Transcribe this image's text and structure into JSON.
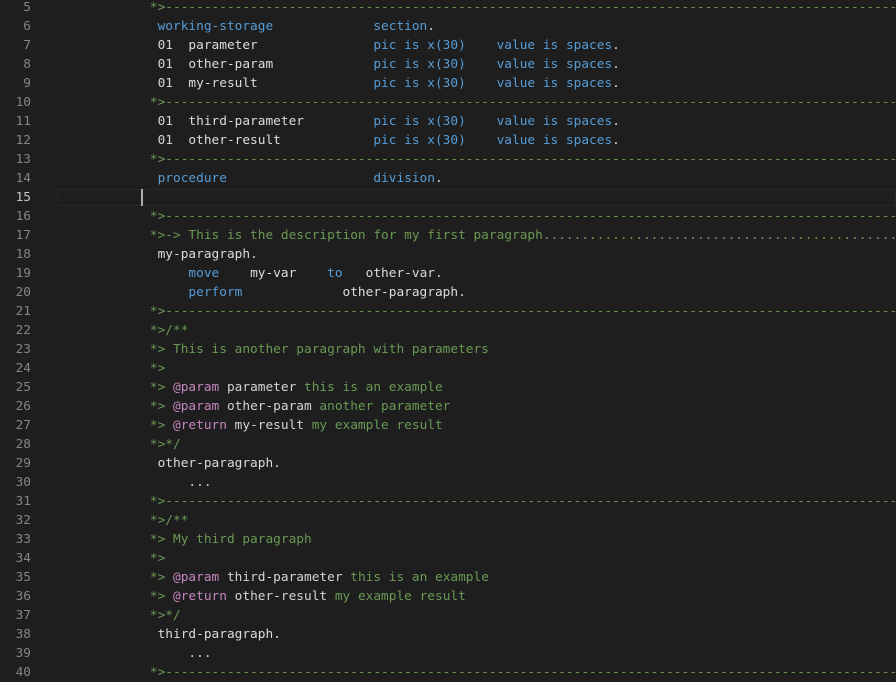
{
  "editor": {
    "colors": {
      "background": "#1e1e1e",
      "line_number": "#858585",
      "active_line_number": "#c6c6c6",
      "comment": "#6a9955",
      "keyword": "#569cd6",
      "identifier": "#dcdcdc",
      "doc_tag": "#c586c0"
    },
    "active_line": 15,
    "lines": [
      {
        "n": "5",
        "segs": [
          {
            "t": "comment",
            "v": "      *>------------------------------------------------------------------------------------------------------"
          }
        ]
      },
      {
        "n": "6",
        "segs": [
          {
            "t": "kw",
            "v": "       working-storage             section"
          },
          {
            "t": "plain",
            "v": "."
          }
        ]
      },
      {
        "n": "7",
        "segs": [
          {
            "t": "plain",
            "v": "       01  "
          },
          {
            "t": "name",
            "v": "parameter"
          },
          {
            "t": "kw",
            "v": "               pic is x(30)    value is spaces"
          },
          {
            "t": "plain",
            "v": "."
          }
        ]
      },
      {
        "n": "8",
        "segs": [
          {
            "t": "plain",
            "v": "       01  "
          },
          {
            "t": "name",
            "v": "other-param"
          },
          {
            "t": "kw",
            "v": "             pic is x(30)    value is spaces"
          },
          {
            "t": "plain",
            "v": "."
          }
        ]
      },
      {
        "n": "9",
        "segs": [
          {
            "t": "plain",
            "v": "       01  "
          },
          {
            "t": "name",
            "v": "my-result"
          },
          {
            "t": "kw",
            "v": "               pic is x(30)    value is spaces"
          },
          {
            "t": "plain",
            "v": "."
          }
        ]
      },
      {
        "n": "10",
        "segs": [
          {
            "t": "comment",
            "v": "      *>------------------------------------------------------------------------------------------------------"
          }
        ]
      },
      {
        "n": "11",
        "segs": [
          {
            "t": "plain",
            "v": "       01  "
          },
          {
            "t": "name",
            "v": "third-parameter"
          },
          {
            "t": "kw",
            "v": "         pic is x(30)    value is spaces"
          },
          {
            "t": "plain",
            "v": "."
          }
        ]
      },
      {
        "n": "12",
        "segs": [
          {
            "t": "plain",
            "v": "       01  "
          },
          {
            "t": "name",
            "v": "other-result"
          },
          {
            "t": "kw",
            "v": "            pic is x(30)    value is spaces"
          },
          {
            "t": "plain",
            "v": "."
          }
        ]
      },
      {
        "n": "13",
        "segs": [
          {
            "t": "comment",
            "v": "      *>------------------------------------------------------------------------------------------------------"
          }
        ]
      },
      {
        "n": "14",
        "segs": [
          {
            "t": "kw",
            "v": "       procedure                   division"
          },
          {
            "t": "plain",
            "v": "."
          }
        ]
      },
      {
        "n": "15",
        "segs": []
      },
      {
        "n": "16",
        "segs": [
          {
            "t": "comment",
            "v": "      *>------------------------------------------------------------------------------------------------------"
          }
        ]
      },
      {
        "n": "17",
        "segs": [
          {
            "t": "comment",
            "v": "      *>-> This is the description for my first paragraph......................................................"
          }
        ]
      },
      {
        "n": "18",
        "segs": [
          {
            "t": "name",
            "v": "       my-paragraph"
          },
          {
            "t": "plain",
            "v": "."
          }
        ]
      },
      {
        "n": "19",
        "segs": [
          {
            "t": "kw",
            "v": "           move    "
          },
          {
            "t": "name",
            "v": "my-var"
          },
          {
            "t": "kw",
            "v": "    to   "
          },
          {
            "t": "name",
            "v": "other-var"
          },
          {
            "t": "plain",
            "v": "."
          }
        ]
      },
      {
        "n": "20",
        "segs": [
          {
            "t": "kw",
            "v": "           perform             "
          },
          {
            "t": "name",
            "v": "other-paragraph"
          },
          {
            "t": "plain",
            "v": "."
          }
        ]
      },
      {
        "n": "21",
        "segs": [
          {
            "t": "comment",
            "v": "      *>------------------------------------------------------------------------------------------------------"
          }
        ]
      },
      {
        "n": "22",
        "segs": [
          {
            "t": "comment",
            "v": "      *>/**"
          }
        ]
      },
      {
        "n": "23",
        "segs": [
          {
            "t": "comment",
            "v": "      *> This is another paragraph with parameters"
          }
        ]
      },
      {
        "n": "24",
        "segs": [
          {
            "t": "comment",
            "v": "      *>"
          }
        ]
      },
      {
        "n": "25",
        "segs": [
          {
            "t": "comment",
            "v": "      *> "
          },
          {
            "t": "tag",
            "v": "@param"
          },
          {
            "t": "plain",
            "v": " parameter"
          },
          {
            "t": "comment",
            "v": " this is an example"
          }
        ]
      },
      {
        "n": "26",
        "segs": [
          {
            "t": "comment",
            "v": "      *> "
          },
          {
            "t": "tag",
            "v": "@param"
          },
          {
            "t": "plain",
            "v": " other-param"
          },
          {
            "t": "comment",
            "v": " another parameter"
          }
        ]
      },
      {
        "n": "27",
        "segs": [
          {
            "t": "comment",
            "v": "      *> "
          },
          {
            "t": "tag",
            "v": "@return"
          },
          {
            "t": "plain",
            "v": " my-result"
          },
          {
            "t": "comment",
            "v": " my example result"
          }
        ]
      },
      {
        "n": "28",
        "segs": [
          {
            "t": "comment",
            "v": "      *>*/"
          }
        ]
      },
      {
        "n": "29",
        "segs": [
          {
            "t": "name",
            "v": "       other-paragraph"
          },
          {
            "t": "plain",
            "v": "."
          }
        ]
      },
      {
        "n": "30",
        "segs": [
          {
            "t": "plain",
            "v": "           ..."
          }
        ]
      },
      {
        "n": "31",
        "segs": [
          {
            "t": "comment",
            "v": "      *>------------------------------------------------------------------------------------------------------"
          }
        ]
      },
      {
        "n": "32",
        "segs": [
          {
            "t": "comment",
            "v": "      *>/**"
          }
        ]
      },
      {
        "n": "33",
        "segs": [
          {
            "t": "comment",
            "v": "      *> My third paragraph"
          }
        ]
      },
      {
        "n": "34",
        "segs": [
          {
            "t": "comment",
            "v": "      *>"
          }
        ]
      },
      {
        "n": "35",
        "segs": [
          {
            "t": "comment",
            "v": "      *> "
          },
          {
            "t": "tag",
            "v": "@param"
          },
          {
            "t": "plain",
            "v": " third-parameter"
          },
          {
            "t": "comment",
            "v": " this is an example"
          }
        ]
      },
      {
        "n": "36",
        "segs": [
          {
            "t": "comment",
            "v": "      *> "
          },
          {
            "t": "tag",
            "v": "@return"
          },
          {
            "t": "plain",
            "v": " other-result"
          },
          {
            "t": "comment",
            "v": " my example result"
          }
        ]
      },
      {
        "n": "37",
        "segs": [
          {
            "t": "comment",
            "v": "      *>*/"
          }
        ]
      },
      {
        "n": "38",
        "segs": [
          {
            "t": "name",
            "v": "       third-paragraph"
          },
          {
            "t": "plain",
            "v": "."
          }
        ]
      },
      {
        "n": "39",
        "segs": [
          {
            "t": "plain",
            "v": "           ..."
          }
        ]
      },
      {
        "n": "40",
        "segs": [
          {
            "t": "comment",
            "v": "      *>------------------------------------------------------------------------------------------------------"
          }
        ]
      }
    ]
  }
}
